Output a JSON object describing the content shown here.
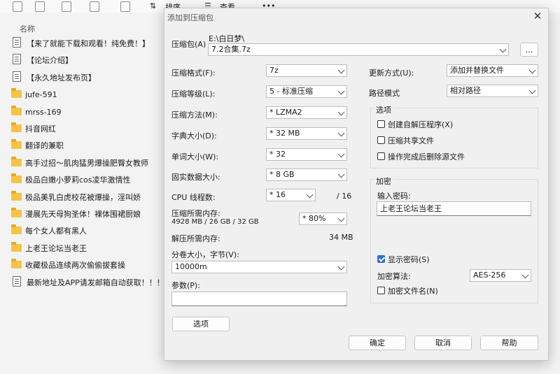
{
  "explorer": {
    "toolbar": {
      "sort_label": "排序",
      "view_label": "查看",
      "more_label": "•••"
    },
    "column_name": "名称",
    "files": [
      {
        "type": "doc",
        "name": "【来了就能下载和观看！纯免费！】"
      },
      {
        "type": "doc",
        "name": "【论坛介绍】"
      },
      {
        "type": "doc",
        "name": "【永久地址发布页】"
      },
      {
        "type": "folder",
        "name": "jufe-591"
      },
      {
        "type": "folder",
        "name": "mrss-169"
      },
      {
        "type": "folder",
        "name": "抖音网红"
      },
      {
        "type": "folder",
        "name": "翻译的兼职"
      },
      {
        "type": "folder",
        "name": "高手过招～肌肉猛男爆操肥臀女教师"
      },
      {
        "type": "folder",
        "name": "极品白嫩小萝莉cos凌华激情性"
      },
      {
        "type": "folder",
        "name": "极品美乳白虎校花被爆操，淫叫娇"
      },
      {
        "type": "folder",
        "name": "漫展先天母狗圣体！裸体围裙厨娘"
      },
      {
        "type": "folder",
        "name": "每个女人都有黑人"
      },
      {
        "type": "folder",
        "name": "上老王论坛当老王"
      },
      {
        "type": "folder",
        "name": "收藏极品连续两次偷偷拔套操"
      },
      {
        "type": "doc",
        "name": "最新地址及APP请发邮箱自动获取！！！"
      }
    ]
  },
  "dialog": {
    "title": "添加到压缩包",
    "close": "✕",
    "archive_label": "压缩包(A)",
    "archive_path": "E:\\白日梦\\",
    "archive_name": "7.2合集.7z",
    "browse_label": "...",
    "format_label": "压缩格式(F):",
    "format_value": "7z",
    "level_label": "压缩等级(L):",
    "level_value": "5 - 标准压缩",
    "method_label": "压缩方法(M):",
    "method_value": "* LZMA2",
    "dict_label": "字典大小(D):",
    "dict_value": "* 32 MB",
    "word_label": "单词大小(W):",
    "word_value": "* 32",
    "solid_label": "固实数据大小:",
    "solid_value": "* 8 GB",
    "cpu_label": "CPU 线程数:",
    "cpu_value": "* 16",
    "cpu_total": "/ 16",
    "mem_comp_label": "压缩所需内存:",
    "mem_comp_detail": "4928 MB / 26 GB / 32 GB",
    "mem_pct_value": "* 80%",
    "mem_decomp_label": "解压所需内存:",
    "mem_decomp_value": "34 MB",
    "split_label": "分卷大小，字节(V):",
    "split_value": "10000m",
    "params_label": "参数(P):",
    "params_value": "",
    "options_button": "选项",
    "update_label": "更新方式(U):",
    "update_value": "添加并替换文件",
    "path_label": "路径模式",
    "path_value": "相对路径",
    "options_group": "选项",
    "opt_sfx": "创建自解压程序(X)",
    "opt_shared": "压缩共享文件",
    "opt_delete": "操作完成后删除源文件",
    "encrypt_group": "加密",
    "pwd_label": "输入密码:",
    "pwd_value": "上老王论坛当老王",
    "show_pwd": "显示密码(S)",
    "algo_label": "加密算法:",
    "algo_value": "AES-256",
    "encrypt_names": "加密文件名(N)",
    "ok": "确定",
    "cancel": "取消",
    "help": "帮助"
  }
}
